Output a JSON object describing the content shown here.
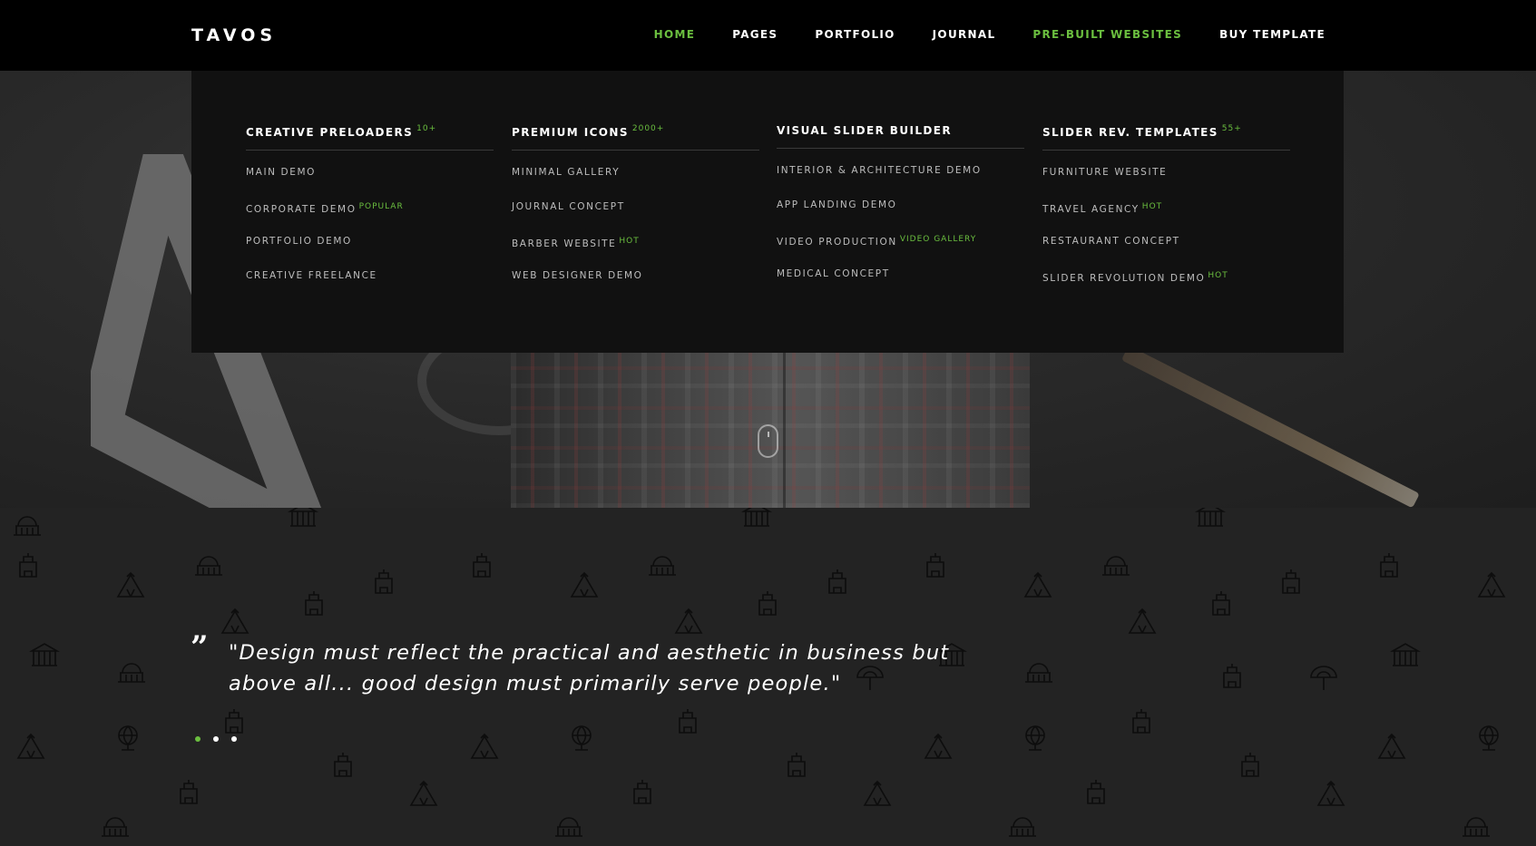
{
  "brand": {
    "logo": "TAVOS",
    "accent_color": "#6bbf3f"
  },
  "nav": {
    "items": [
      {
        "label": "HOME",
        "active": true
      },
      {
        "label": "PAGES",
        "active": false
      },
      {
        "label": "PORTFOLIO",
        "active": false
      },
      {
        "label": "JOURNAL",
        "active": false
      },
      {
        "label": "PRE-BUILT WEBSITES",
        "active": true
      },
      {
        "label": "BUY TEMPLATE",
        "active": false
      }
    ]
  },
  "mega_menu": {
    "columns": [
      {
        "title": "CREATIVE PRELOADERS",
        "sup": "10+",
        "items": [
          {
            "label": "MAIN DEMO",
            "badge": ""
          },
          {
            "label": "CORPORATE DEMO",
            "badge": "POPULAR"
          },
          {
            "label": "PORTFOLIO DEMO",
            "badge": ""
          },
          {
            "label": "CREATIVE FREELANCE",
            "badge": ""
          }
        ]
      },
      {
        "title": "PREMIUM ICONS",
        "sup": "2000+",
        "items": [
          {
            "label": "MINIMAL GALLERY",
            "badge": ""
          },
          {
            "label": "JOURNAL CONCEPT",
            "badge": ""
          },
          {
            "label": "BARBER WEBSITE",
            "badge": "HOT"
          },
          {
            "label": "WEB DESIGNER DEMO",
            "badge": ""
          }
        ]
      },
      {
        "title": "VISUAL SLIDER BUILDER",
        "sup": "",
        "items": [
          {
            "label": "INTERIOR & ARCHITECTURE DEMO",
            "badge": ""
          },
          {
            "label": "APP LANDING DEMO",
            "badge": ""
          },
          {
            "label": "VIDEO PRODUCTION",
            "badge": "VIDEO GALLERY"
          },
          {
            "label": "MEDICAL CONCEPT",
            "badge": ""
          }
        ]
      },
      {
        "title": "SLIDER REV. TEMPLATES",
        "sup": "55+",
        "items": [
          {
            "label": "FURNITURE WEBSITE",
            "badge": ""
          },
          {
            "label": "TRAVEL AGENCY",
            "badge": "HOT"
          },
          {
            "label": "RESTAURANT CONCEPT",
            "badge": ""
          },
          {
            "label": "SLIDER REVOLUTION DEMO",
            "badge": "HOT"
          }
        ]
      }
    ]
  },
  "testimonial": {
    "quote_mark": "”",
    "line1": "\"Design must reflect the practical and aesthetic in business but",
    "line2": "above all... good design must primarily serve people.\"",
    "slides": 3,
    "active_slide": 0
  },
  "icons": {
    "scroll_indicator": "mouse-scroll-icon",
    "pattern": "landmark-icons-pattern"
  }
}
